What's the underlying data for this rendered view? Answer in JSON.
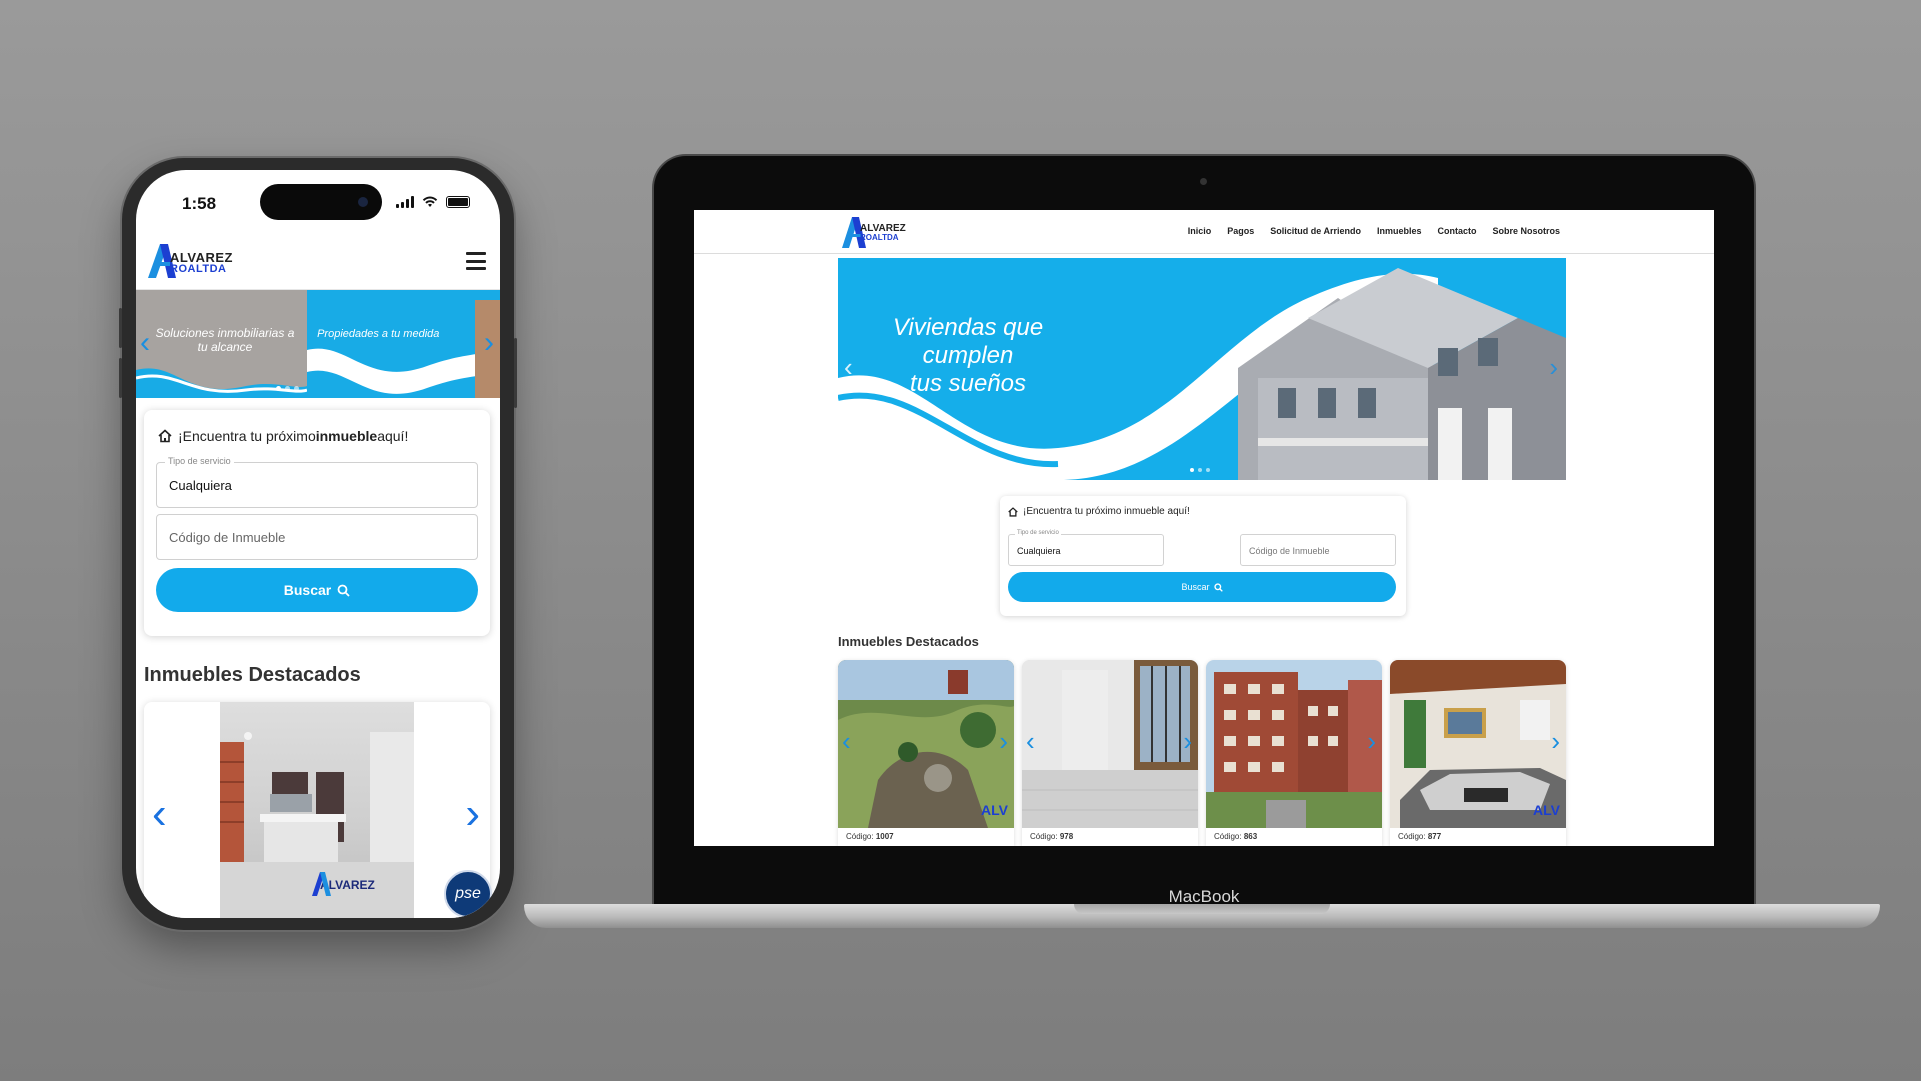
{
  "colors": {
    "brand_blue": "#12aaeb",
    "accent_arrow": "#1a8fe0",
    "logo_blue": "#1c3fd1"
  },
  "phone": {
    "status_time": "1:58",
    "brand": {
      "name_line1": "ALVAREZ",
      "name_line2": "ROALTDA"
    },
    "hero": {
      "slide_left_text": "Soluciones inmobiliarias a tu alcance",
      "slide_right_text": "Propiedades a tu medida"
    },
    "search": {
      "title_pre": "¡Encuentra tu próximo ",
      "title_bold": "inmueble",
      "title_post": " aquí!",
      "service_label": "Tipo de servicio",
      "service_value": "Cualquiera",
      "code_placeholder": "Código de Inmueble",
      "button_label": "Buscar"
    },
    "featured_title": "Inmuebles Destacados",
    "card_watermark": "ALVAREZ",
    "pse_label": "pse"
  },
  "laptop": {
    "model_label": "MacBook",
    "brand": {
      "name_line1": "ALVAREZ",
      "name_line2": "ROALTDA"
    },
    "nav": [
      "Inicio",
      "Pagos",
      "Solicitud de Arriendo",
      "Inmuebles",
      "Contacto",
      "Sobre Nosotros"
    ],
    "hero": {
      "title_line1": "Viviendas que cumplen",
      "title_line2": "tus sueños"
    },
    "search": {
      "title": "¡Encuentra tu próximo inmueble aquí!",
      "service_label": "Tipo de servicio",
      "service_value": "Cualquiera",
      "code_placeholder": "Código de Inmueble",
      "button_label": "Buscar"
    },
    "featured_title": "Inmuebles Destacados",
    "cards": [
      {
        "code_label": "Código:",
        "code": "1007",
        "photo": "garden"
      },
      {
        "code_label": "Código:",
        "code": "978",
        "photo": "empty-room"
      },
      {
        "code_label": "Código:",
        "code": "863",
        "photo": "brick-buildings"
      },
      {
        "code_label": "Código:",
        "code": "877",
        "photo": "living-room"
      }
    ],
    "card_watermark": "ALV"
  }
}
